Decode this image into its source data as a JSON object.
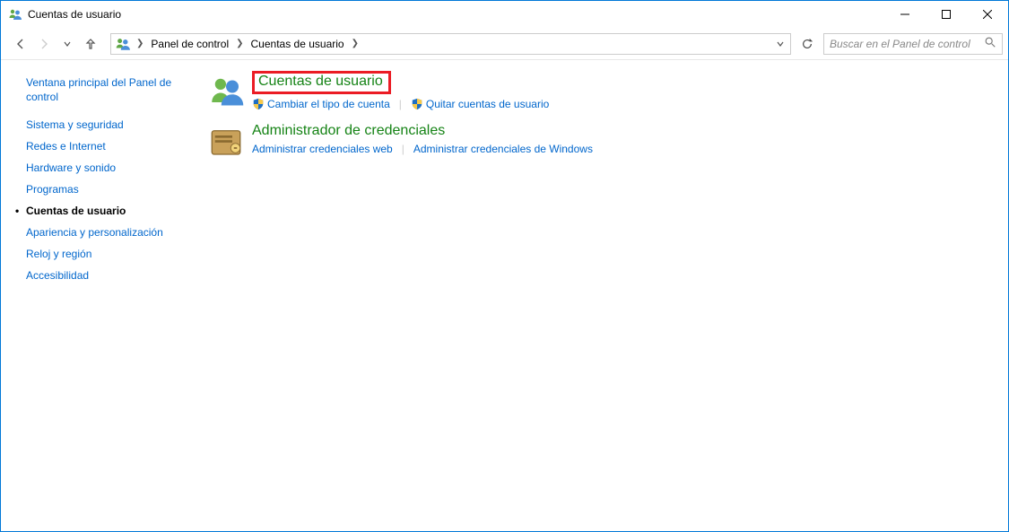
{
  "window": {
    "title": "Cuentas de usuario"
  },
  "breadcrumb": {
    "items": [
      "Panel de control",
      "Cuentas de usuario"
    ]
  },
  "search": {
    "placeholder": "Buscar en el Panel de control"
  },
  "sidebar": {
    "home": "Ventana principal del Panel de control",
    "items": [
      {
        "label": "Sistema y seguridad",
        "active": false
      },
      {
        "label": "Redes e Internet",
        "active": false
      },
      {
        "label": "Hardware y sonido",
        "active": false
      },
      {
        "label": "Programas",
        "active": false
      },
      {
        "label": "Cuentas de usuario",
        "active": true
      },
      {
        "label": "Apariencia y personalización",
        "active": false
      },
      {
        "label": "Reloj y región",
        "active": false
      },
      {
        "label": "Accesibilidad",
        "active": false
      }
    ]
  },
  "main": {
    "categories": [
      {
        "title": "Cuentas de usuario",
        "highlighted": true,
        "links": [
          {
            "label": "Cambiar el tipo de cuenta",
            "shield": true
          },
          {
            "label": "Quitar cuentas de usuario",
            "shield": true
          }
        ]
      },
      {
        "title": "Administrador de credenciales",
        "highlighted": false,
        "links": [
          {
            "label": "Administrar credenciales web",
            "shield": false
          },
          {
            "label": "Administrar credenciales de Windows",
            "shield": false
          }
        ]
      }
    ]
  }
}
